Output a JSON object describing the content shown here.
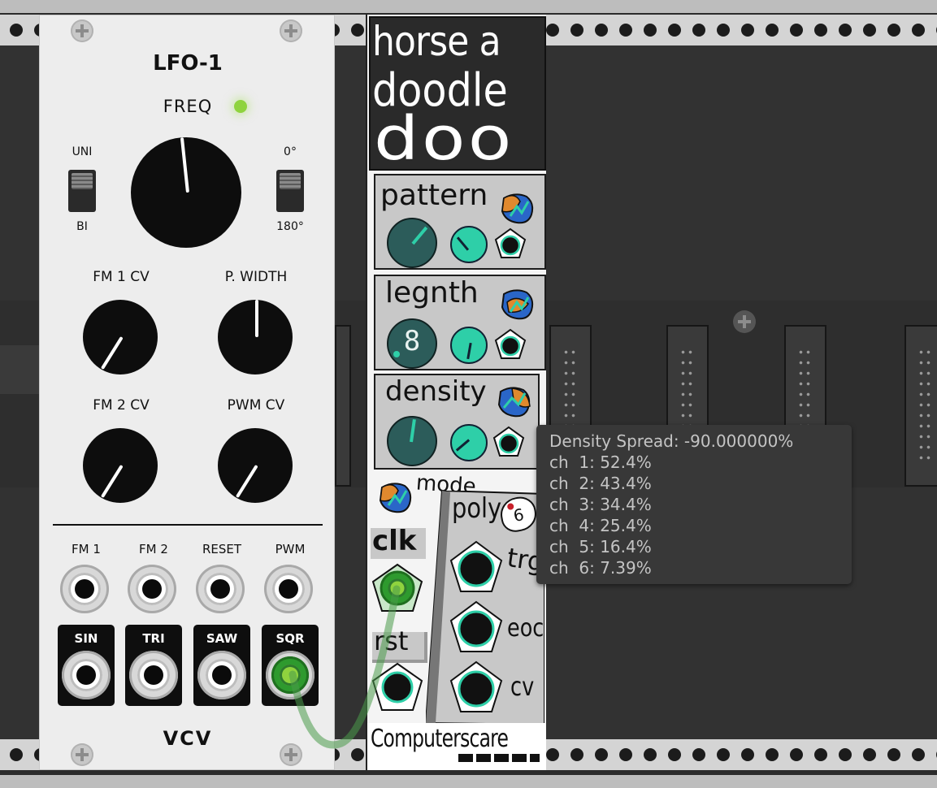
{
  "lfo": {
    "title": "LFO-1",
    "freq_label": "FREQ",
    "switch1_top": "UNI",
    "switch1_bottom": "BI",
    "switch2_top": "0°",
    "switch2_bottom": "180°",
    "knob_labels": [
      "FM 1 CV",
      "P. WIDTH",
      "FM 2 CV",
      "PWM CV"
    ],
    "input_labels": [
      "FM 1",
      "FM 2",
      "RESET",
      "PWM"
    ],
    "output_labels": [
      "SIN",
      "TRI",
      "SAW",
      "SQR"
    ],
    "brand": "VCV",
    "led_color": "#8fd33e"
  },
  "horse": {
    "title_lines": [
      "horse a",
      "doodle",
      "doo"
    ],
    "sections": [
      "pattern",
      "legnth",
      "density"
    ],
    "length_value": "8",
    "mode_label": "mode",
    "poly_label": "poly",
    "poly_value": "6",
    "clk_label": "clk",
    "rst_label": "rst",
    "out_labels": [
      "trg",
      "eoc",
      "cv"
    ],
    "brand": "Computerscare",
    "accent_teal": "#2ecfa8",
    "accent_orange": "#e0892e",
    "accent_blue": "#2a66c8"
  },
  "tooltip": {
    "lines": [
      "Density Spread: -90.000000%",
      "ch  1: 52.4%",
      "ch  2: 43.4%",
      "ch  3: 34.4%",
      "ch  4: 25.4%",
      "ch  5: 16.4%",
      "ch  6: 7.39%"
    ]
  },
  "cable_color": "#4a9a4a"
}
